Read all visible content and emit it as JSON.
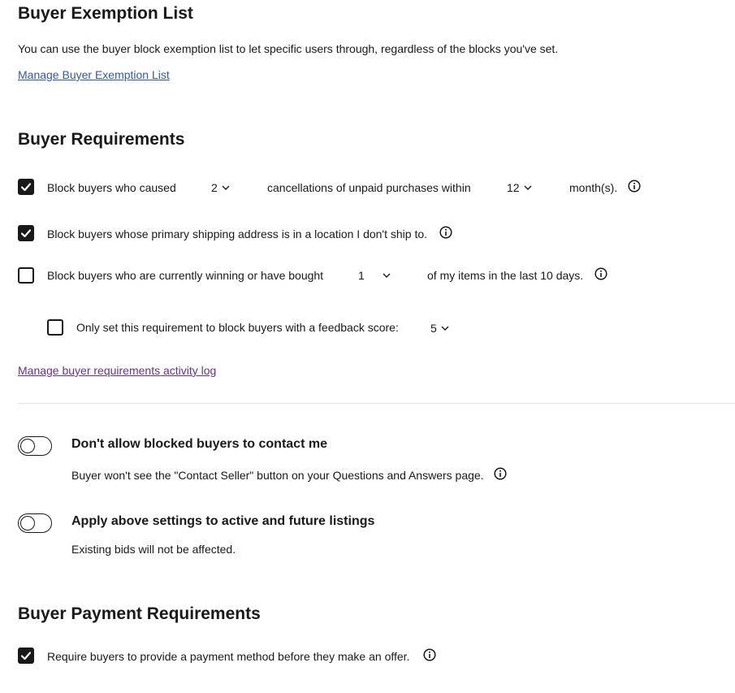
{
  "exemption": {
    "heading": "Buyer Exemption List",
    "description": "You can use the buyer block exemption list to let specific users through, regardless of the blocks you've set.",
    "link": "Manage Buyer Exemption List"
  },
  "requirements": {
    "heading": "Buyer Requirements",
    "row1": {
      "checked": true,
      "text_before": "Block buyers who caused",
      "count_value": "2",
      "text_middle": "cancellations of unpaid purchases within",
      "months_value": "12",
      "text_after": "month(s)."
    },
    "row2": {
      "checked": true,
      "text": "Block buyers whose primary shipping address is in a location I don't ship to."
    },
    "row3": {
      "checked": false,
      "text_before": "Block buyers who are currently winning or have bought",
      "items_value": "1",
      "text_after": "of my items in the last 10 days."
    },
    "row3_sub": {
      "checked": false,
      "text": "Only set this requirement to block buyers with a feedback score:",
      "score_value": "5"
    },
    "activity_link": "Manage buyer requirements activity log"
  },
  "toggles": {
    "contact": {
      "on": false,
      "title": "Don't allow blocked buyers to contact me",
      "description": "Buyer won't see the \"Contact Seller\" button on your Questions and Answers page."
    },
    "apply": {
      "on": false,
      "title": "Apply above settings to active and future listings",
      "description": "Existing bids will not be affected."
    }
  },
  "payment": {
    "heading": "Buyer Payment Requirements",
    "row": {
      "checked": true,
      "text": "Require buyers to provide a payment method before they make an offer."
    }
  },
  "icons": {
    "checkmark": "checkmark-icon",
    "chevron": "chevron-down-icon",
    "info": "info-icon"
  }
}
